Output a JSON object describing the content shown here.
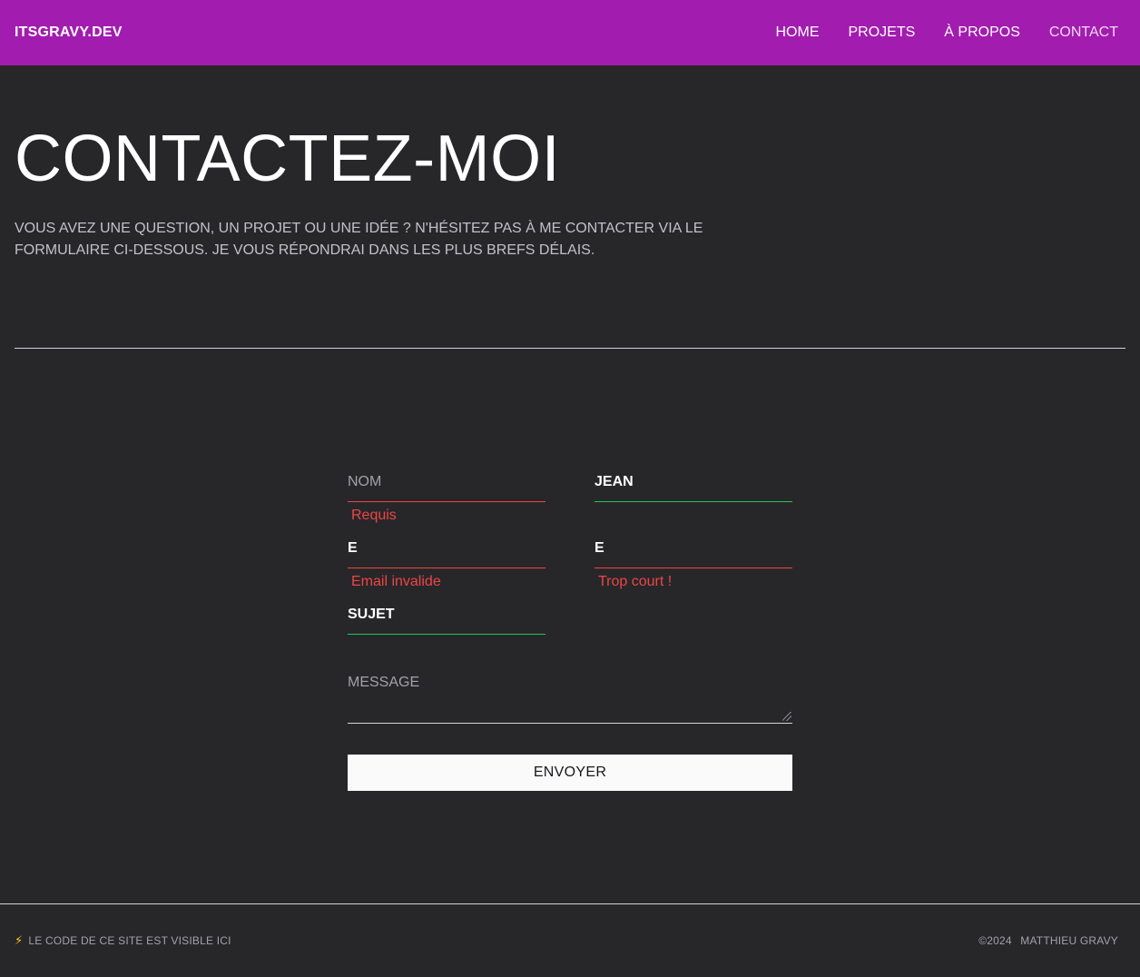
{
  "header": {
    "brand": "ITSGRAVY.DEV",
    "nav": [
      {
        "label": "HOME"
      },
      {
        "label": "PROJETS"
      },
      {
        "label": "À PROPOS"
      },
      {
        "label": "CONTACT"
      }
    ]
  },
  "hero": {
    "title": "CONTACTEZ-MOI",
    "text": "VOUS AVEZ UNE QUESTION, UN PROJET OU UNE IDÉE ? N'HÉSITEZ PAS À ME CONTACTER VIA LE FORMULAIRE CI-DESSOUS. JE VOUS RÉPONDRAI DANS LES PLUS BREFS DÉLAIS."
  },
  "form": {
    "nom": {
      "placeholder": "NOM",
      "value": "",
      "error": "Requis"
    },
    "prenom": {
      "value": "JEAN"
    },
    "email": {
      "value": "E",
      "error": "Email invalide"
    },
    "telephone": {
      "value": "E",
      "error": "Trop court !"
    },
    "sujet": {
      "value": "SUJET"
    },
    "message": {
      "placeholder": "MESSAGE"
    },
    "submit_label": "ENVOYER"
  },
  "footer": {
    "source_text": "LE CODE DE CE SITE EST VISIBLE ICI",
    "copyright": "©2024",
    "author": "MATTHIEU GRAVY"
  },
  "colors": {
    "header_bg": "#a21caf",
    "page_bg": "#27272a",
    "error": "#ef4444",
    "valid": "#22c55e"
  },
  "icons": {
    "footer_icon": "lightning-bolt-icon"
  }
}
